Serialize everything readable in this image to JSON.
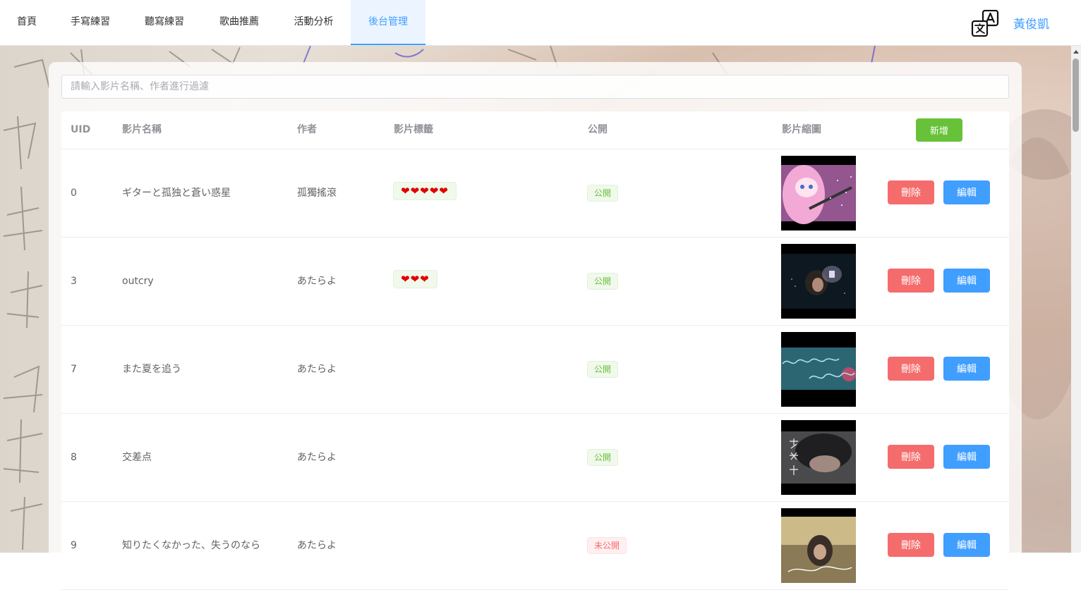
{
  "nav": {
    "items": [
      "首頁",
      "手寫練習",
      "聽寫練習",
      "歌曲推薦",
      "活動分析",
      "後台管理"
    ],
    "active": "後台管理",
    "translate_icon": "translate-icon",
    "user": "黃俊凱"
  },
  "search": {
    "placeholder": "請輸入影片名稱、作者進行過濾",
    "value": ""
  },
  "table": {
    "headers": {
      "uid": "UID",
      "name": "影片名稱",
      "author": "作者",
      "tags": "影片標籤",
      "public": "公開",
      "thumb": "影片縮圖"
    },
    "add_label": "新增",
    "delete_label": "刪除",
    "edit_label": "編輯",
    "rows": [
      {
        "uid": "0",
        "name": "ギターと孤独と蒼い惑星",
        "author": "孤獨搖滾",
        "tags": "❤❤❤❤❤",
        "status": "公開"
      },
      {
        "uid": "3",
        "name": "outcry",
        "author": "あたらよ",
        "tags": "❤❤❤",
        "status": "公開"
      },
      {
        "uid": "7",
        "name": "また夏を追う",
        "author": "あたらよ",
        "tags": "",
        "status": "公開"
      },
      {
        "uid": "8",
        "name": "交差点",
        "author": "あたらよ",
        "tags": "",
        "status": "公開"
      },
      {
        "uid": "9",
        "name": "知りたくなかった、失うのなら",
        "author": "あたらよ",
        "tags": "",
        "status": "未公開"
      }
    ]
  },
  "colors": {
    "accent": "#409eff",
    "success": "#67c23a",
    "danger": "#f56c6c",
    "heart": "#e00000"
  }
}
